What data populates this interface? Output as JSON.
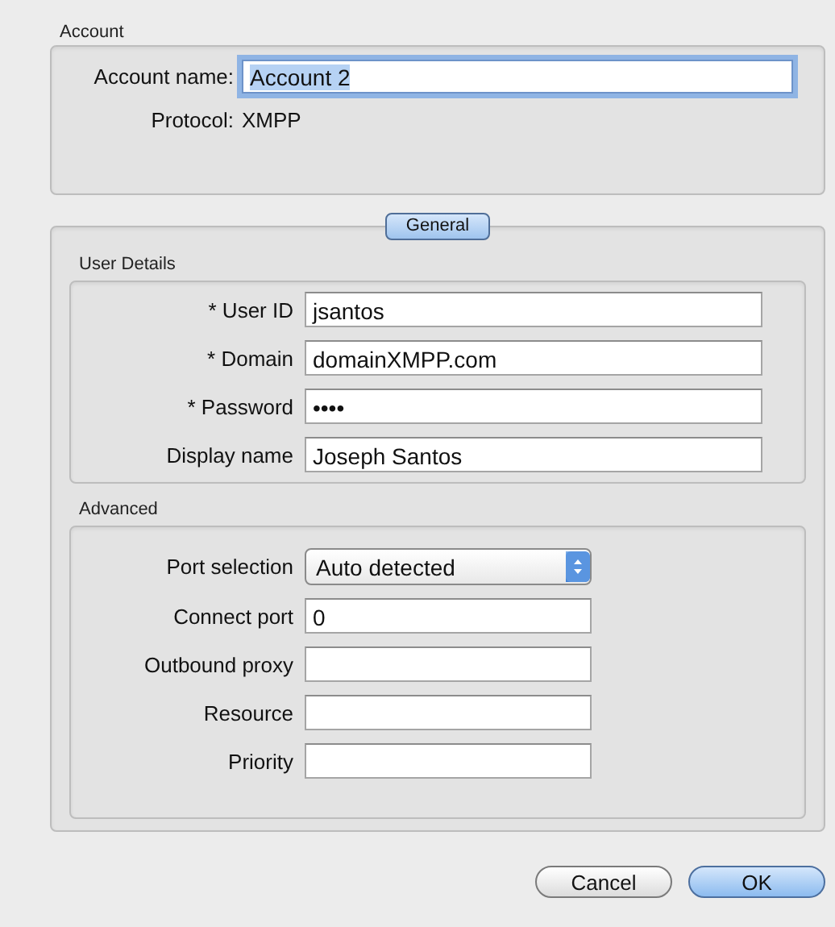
{
  "account": {
    "title": "Account",
    "name_label": "Account name:",
    "name_value": "Account 2",
    "name_text_selected": true,
    "protocol_label": "Protocol:",
    "protocol_value": "XMPP"
  },
  "tabs": [
    {
      "label": "General",
      "selected": true
    }
  ],
  "user_details": {
    "title": "User Details",
    "fields": [
      {
        "label": "* User ID",
        "value": "jsantos"
      },
      {
        "label": "* Domain",
        "value": "domainXMPP.com"
      },
      {
        "label": "* Password",
        "value": "••••"
      },
      {
        "label": "Display name",
        "value": "Joseph Santos"
      }
    ]
  },
  "advanced": {
    "title": "Advanced",
    "fields": [
      {
        "kind": "select",
        "label": "Port selection",
        "value": "Auto detected"
      },
      {
        "kind": "text",
        "label": "Connect port",
        "value": "0"
      },
      {
        "kind": "text",
        "label": "Outbound proxy"
      },
      {
        "kind": "text",
        "label": "Resource"
      },
      {
        "kind": "text",
        "label": "Priority"
      }
    ]
  },
  "buttons": [
    {
      "label": "Cancel",
      "default": false
    },
    {
      "label": "OK",
      "default": true
    }
  ]
}
